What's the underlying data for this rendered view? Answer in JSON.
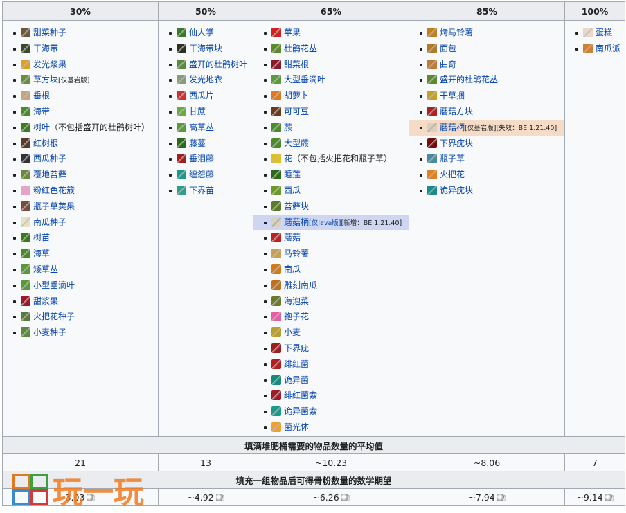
{
  "headers": [
    "30%",
    "50%",
    "65%",
    "85%",
    "100%"
  ],
  "columns": [
    {
      "items": [
        {
          "label": "甜菜种子",
          "icon": "beetroot-seeds-icon",
          "color": "#6b5a3a"
        },
        {
          "label": "干海带",
          "icon": "dried-kelp-icon",
          "color": "#3d4a2a"
        },
        {
          "label": "发光浆果",
          "icon": "glow-berries-icon",
          "color": "#e0a020"
        },
        {
          "label": "草方块",
          "icon": "grass-block-icon",
          "color": "#6b8e3a",
          "note": "[仅基岩版]"
        },
        {
          "label": "垂根",
          "icon": "hanging-roots-icon",
          "color": "#c9a27a"
        },
        {
          "label": "海带",
          "icon": "kelp-icon",
          "color": "#4a8a2a"
        },
        {
          "label": "树叶",
          "icon": "leaves-icon",
          "color": "#3f7a1f",
          "suffix": "（不包括盛开的杜鹃树叶）"
        },
        {
          "label": "红树根",
          "icon": "mangrove-roots-icon",
          "color": "#5a3a2a"
        },
        {
          "label": "西瓜种子",
          "icon": "melon-seeds-icon",
          "color": "#333333"
        },
        {
          "label": "覆地苔藓",
          "icon": "moss-carpet-icon",
          "color": "#6a8a3a"
        },
        {
          "label": "粉红色花簇",
          "icon": "pink-petals-icon",
          "color": "#f0a0c8"
        },
        {
          "label": "瓶子草荚果",
          "icon": "pitcher-pod-icon",
          "color": "#7a4a3a"
        },
        {
          "label": "南瓜种子",
          "icon": "pumpkin-seeds-icon",
          "color": "#e8e0c0"
        },
        {
          "label": "树苗",
          "icon": "sapling-icon",
          "color": "#3a7a1a"
        },
        {
          "label": "海草",
          "icon": "seagrass-icon",
          "color": "#4a8a2a"
        },
        {
          "label": "矮草丛",
          "icon": "short-grass-icon",
          "color": "#5a9a3a"
        },
        {
          "label": "小型垂滴叶",
          "icon": "small-dripleaf-icon",
          "color": "#5a9a3a"
        },
        {
          "label": "甜浆果",
          "icon": "sweet-berries-icon",
          "color": "#9a1a2a"
        },
        {
          "label": "火把花种子",
          "icon": "torchflower-seeds-icon",
          "color": "#5a7a3a"
        },
        {
          "label": "小麦种子",
          "icon": "wheat-seeds-icon",
          "color": "#5a8a3a"
        }
      ]
    },
    {
      "items": [
        {
          "label": "仙人掌",
          "icon": "cactus-icon",
          "color": "#3a7a2a"
        },
        {
          "label": "干海带块",
          "icon": "dried-kelp-block-icon",
          "color": "#2a3022"
        },
        {
          "label": "盛开的杜鹃树叶",
          "icon": "flowering-azalea-leaves-icon",
          "color": "#5a8a3a"
        },
        {
          "label": "发光地衣",
          "icon": "glow-lichen-icon",
          "color": "#8a9a7a"
        },
        {
          "label": "西瓜片",
          "icon": "melon-slice-icon",
          "color": "#d03030"
        },
        {
          "label": "甘蔗",
          "icon": "sugar-cane-icon",
          "color": "#6aaa3a"
        },
        {
          "label": "高草丛",
          "icon": "tall-grass-icon",
          "color": "#5a9a3a"
        },
        {
          "label": "藤蔓",
          "icon": "vines-icon",
          "color": "#2a6a1a"
        },
        {
          "label": "垂泪藤",
          "icon": "weeping-vines-icon",
          "color": "#a02020"
        },
        {
          "label": "缠怨藤",
          "icon": "twisting-vines-icon",
          "color": "#1a9a8a"
        },
        {
          "label": "下界苗",
          "icon": "nether-sprouts-icon",
          "color": "#2aa08a"
        }
      ]
    },
    {
      "items": [
        {
          "label": "苹果",
          "icon": "apple-icon",
          "color": "#d02020"
        },
        {
          "label": "杜鹃花丛",
          "icon": "azalea-icon",
          "color": "#5a8a2a"
        },
        {
          "label": "甜菜根",
          "icon": "beetroot-icon",
          "color": "#8a1a2a"
        },
        {
          "label": "大型垂滴叶",
          "icon": "big-dripleaf-icon",
          "color": "#5a9a3a"
        },
        {
          "label": "胡萝卜",
          "icon": "carrot-icon",
          "color": "#e07a1a"
        },
        {
          "label": "可可豆",
          "icon": "cocoa-beans-icon",
          "color": "#6a3a1a"
        },
        {
          "label": "蕨",
          "icon": "fern-icon",
          "color": "#4a8a2a"
        },
        {
          "label": "大型蕨",
          "icon": "large-fern-icon",
          "color": "#4a8a2a"
        },
        {
          "label": "花",
          "icon": "flower-icon",
          "color": "#e0c020",
          "suffix": "（不包括火把花和瓶子草）"
        },
        {
          "label": "睡莲",
          "icon": "lily-pad-icon",
          "color": "#2a6a1a"
        },
        {
          "label": "西瓜",
          "icon": "melon-icon",
          "color": "#6a9a2a"
        },
        {
          "label": "苔藓块",
          "icon": "moss-block-icon",
          "color": "#5a7a2a"
        },
        {
          "label": "蘑菇柄",
          "icon": "mushroom-stem-icon",
          "color": "#d8d0c0",
          "note": "[仅Java版]",
          "note2": "[新增：BE 1.21.40]",
          "highlight": "new"
        },
        {
          "label": "蘑菇",
          "icon": "mushroom-icon",
          "color": "#c02020"
        },
        {
          "label": "马铃薯",
          "icon": "potato-icon",
          "color": "#c8a050"
        },
        {
          "label": "南瓜",
          "icon": "pumpkin-icon",
          "color": "#d07a1a"
        },
        {
          "label": "雕刻南瓜",
          "icon": "carved-pumpkin-icon",
          "color": "#c0701a"
        },
        {
          "label": "海泡菜",
          "icon": "sea-pickle-icon",
          "color": "#6a7a2a"
        },
        {
          "label": "孢子花",
          "icon": "spore-blossom-icon",
          "color": "#e060a0"
        },
        {
          "label": "小麦",
          "icon": "wheat-icon",
          "color": "#b8a030"
        },
        {
          "label": "下界疣",
          "icon": "nether-wart-icon",
          "color": "#9a2020"
        },
        {
          "label": "绯红菌",
          "icon": "crimson-fungus-icon",
          "color": "#b02020"
        },
        {
          "label": "诡异菌",
          "icon": "warped-fungus-icon",
          "color": "#1a8a7a"
        },
        {
          "label": "绯红菌索",
          "icon": "crimson-roots-icon",
          "color": "#a01a2a"
        },
        {
          "label": "诡异菌索",
          "icon": "warped-roots-icon",
          "color": "#1a9a8a"
        },
        {
          "label": "菌光体",
          "icon": "shroomlight-icon",
          "color": "#f0a030"
        }
      ]
    },
    {
      "items": [
        {
          "label": "烤马铃薯",
          "icon": "baked-potato-icon",
          "color": "#c08020"
        },
        {
          "label": "面包",
          "icon": "bread-icon",
          "color": "#b07a2a"
        },
        {
          "label": "曲奇",
          "icon": "cookie-icon",
          "color": "#c07a3a"
        },
        {
          "label": "盛开的杜鹃花丛",
          "icon": "flowering-azalea-icon",
          "color": "#5a8a2a"
        },
        {
          "label": "干草捆",
          "icon": "hay-bale-icon",
          "color": "#c8a020"
        },
        {
          "label": "蘑菇方块",
          "icon": "mushroom-block-icon",
          "color": "#b02020"
        },
        {
          "label": "蘑菇柄",
          "icon": "mushroom-stem-2-icon",
          "color": "#d8d0c0",
          "note": "[仅基岩版]",
          "note2": "[失效：BE 1.21.40]",
          "highlight": "rm"
        },
        {
          "label": "下界疣块",
          "icon": "nether-wart-block-icon",
          "color": "#7a0a0a"
        },
        {
          "label": "瓶子草",
          "icon": "pitcher-plant-icon",
          "color": "#4a8aa0"
        },
        {
          "label": "火把花",
          "icon": "torchflower-icon",
          "color": "#e08020"
        },
        {
          "label": "诡异疣块",
          "icon": "warped-wart-block-icon",
          "color": "#1a8a8a"
        }
      ]
    },
    {
      "items": [
        {
          "label": "蛋糕",
          "icon": "cake-icon",
          "color": "#e8d8c8"
        },
        {
          "label": "南瓜派",
          "icon": "pumpkin-pie-icon",
          "color": "#d08030"
        }
      ]
    }
  ],
  "avg_header": "填满堆肥桶需要的物品数量的平均值",
  "avg_values": [
    "21",
    "13",
    "~10.23",
    "~8.06",
    "7"
  ],
  "expect_header": "填充一组物品后可得骨粉数量的数学期望",
  "expect_values": [
    "3.03",
    "~4.92",
    "~6.26",
    "~7.94",
    "~9.14"
  ],
  "bonemeal_icon": "bone-meal-icon",
  "watermark": "玩一玩"
}
